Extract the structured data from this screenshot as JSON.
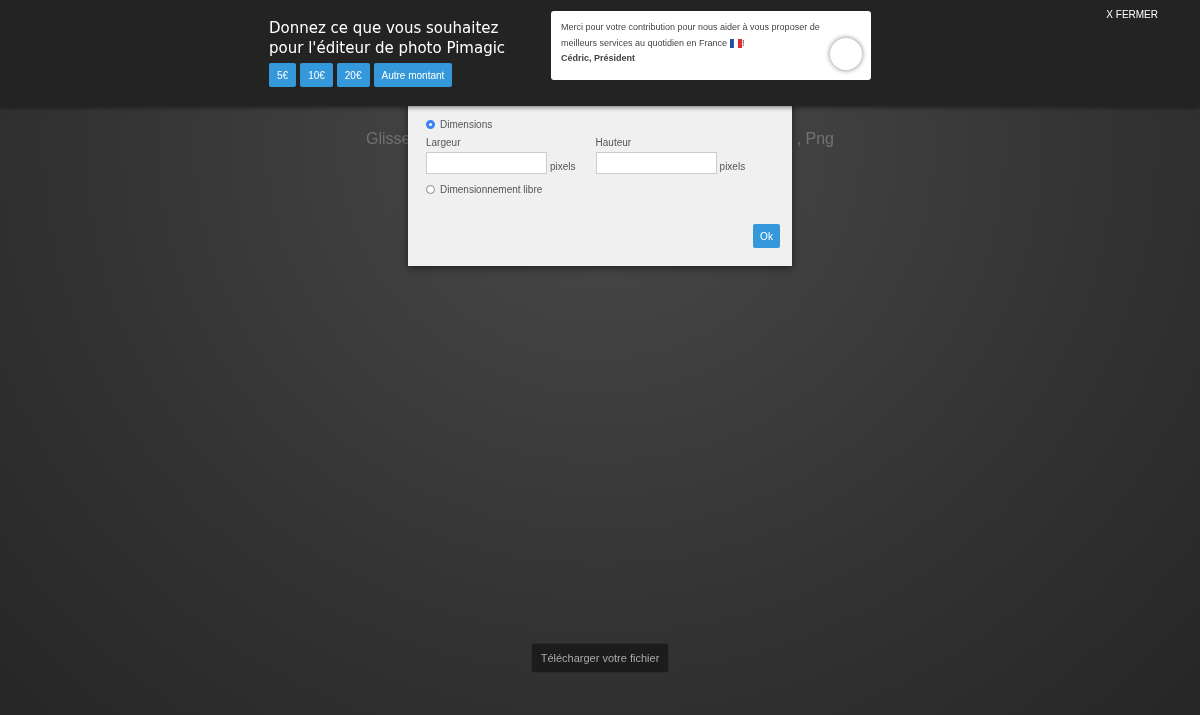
{
  "donation_bar": {
    "title": "Donnez ce que vous souhaitez pour l'éditeur de photo Pimagic",
    "amounts": [
      "5€",
      "10€",
      "20€",
      "Autre montant"
    ],
    "message_lines": [
      "Merci pour votre contribution pour nous aider à vous proposer de",
      "meilleurs services au quotidien en France"
    ],
    "message_end": "!",
    "signature": "Cédric, Président",
    "close": "X FERMER"
  },
  "background": {
    "hint_start": "Glisse",
    "hint_end": ", Png",
    "upload_button": "Télécharger votre fichier"
  },
  "dialog": {
    "options": [
      {
        "label": "Dimensions",
        "selected": true
      },
      {
        "label": "Dimensionnement libre",
        "selected": false
      }
    ],
    "fields": [
      {
        "label": "Largeur",
        "unit": "pixels"
      },
      {
        "label": "Hauteur",
        "unit": "pixels"
      }
    ],
    "ok": "Ok"
  }
}
